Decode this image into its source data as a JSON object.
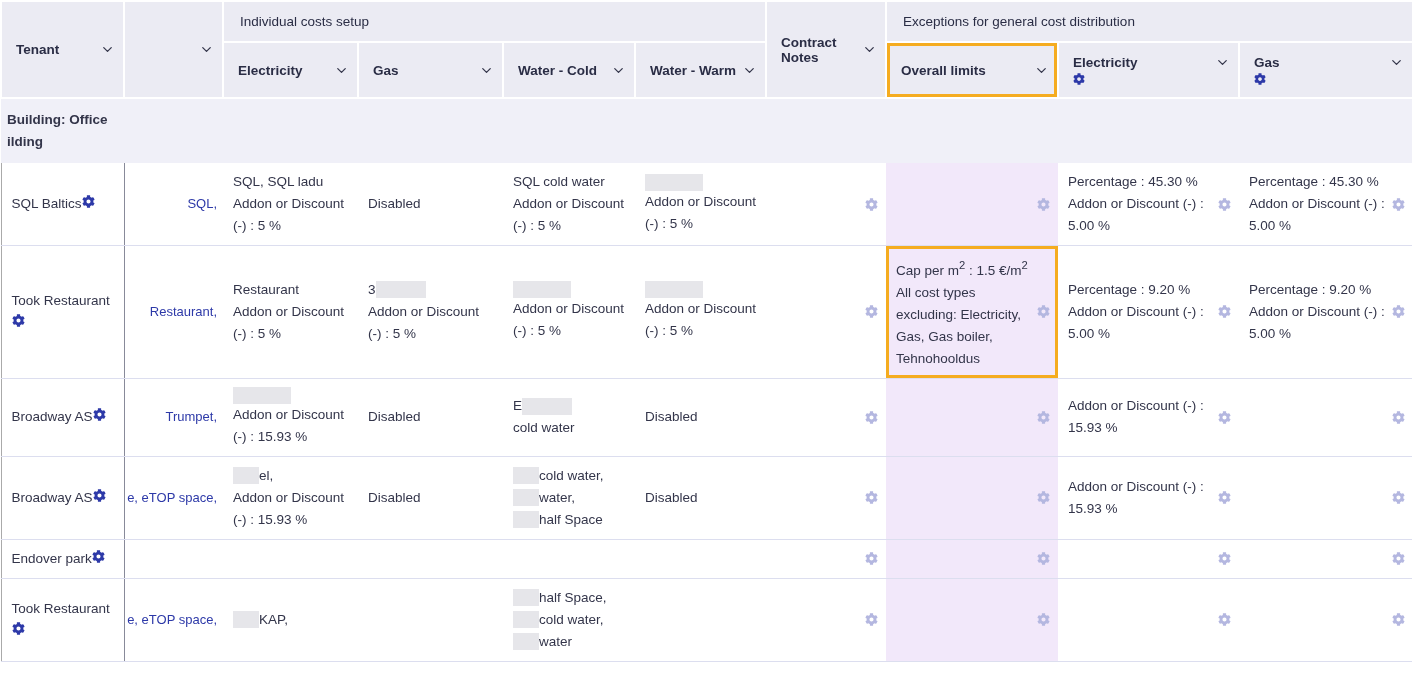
{
  "table": {
    "header": [
      {
        "kind": "column",
        "label": "Tenant"
      },
      {
        "kind": "column"
      },
      {
        "kind": "group",
        "label": "Individual costs setup",
        "columns": [
          {
            "label": "Electricity",
            "gear": false,
            "highlighted": false
          },
          {
            "label": "Gas",
            "gear": false,
            "highlighted": false
          },
          {
            "label": "Water - Cold",
            "gear": false,
            "highlighted": false
          },
          {
            "label": "Water - Warm",
            "gear": false,
            "highlighted": false
          }
        ]
      },
      {
        "kind": "column",
        "label": "Contract Notes"
      },
      {
        "kind": "group",
        "label": "Exceptions for general cost distribution",
        "columns": [
          {
            "label": "Overall limits",
            "gear": false,
            "highlighted": true
          },
          {
            "label": "Electricity",
            "gear": true,
            "highlighted": false
          },
          {
            "label": "Gas",
            "gear": true,
            "highlighted": false
          }
        ]
      }
    ],
    "group_row": {
      "lines": [
        "Building: Office",
        "ilding"
      ]
    },
    "rows": [
      {
        "tenant": "SQL Baltics",
        "link": "SQL,",
        "costs": {
          "electricity": [
            "SQL, SQL ladu",
            "Addon or Discount (-) : 5 %"
          ],
          "gas": [
            "Disabled"
          ],
          "water_cold": [
            "SQL cold water",
            "Addon or Discount (-) : 5 %"
          ],
          "water_warm": [
            {
              "kind": "masked"
            },
            "Addon or Discount (-) : 5 %"
          ]
        },
        "overall": {
          "highlighted": false
        },
        "exceptions": {
          "electricity": [
            "Percentage : 45.30 %",
            "Addon or Discount (-) : 5.00 %"
          ],
          "gas": [
            "Percentage : 45.30 %",
            "Addon or Discount (-) : 5.00 %"
          ]
        }
      },
      {
        "tenant": "Took Restaurant",
        "link": "Restaurant,",
        "costs": {
          "electricity": [
            "Restaurant",
            "Addon or Discount (-) : 5 %"
          ],
          "gas": [
            {
              "kind": "prefix",
              "text": "3"
            },
            "Addon or Discount (-) : 5 %"
          ],
          "water_cold": [
            {
              "kind": "masked"
            },
            "Addon or Discount (-) : 5 %"
          ],
          "water_warm": [
            {
              "kind": "masked"
            },
            "Addon or Discount (-) : 5 %"
          ]
        },
        "overall": {
          "highlighted": true,
          "lines": [
            "Cap per m$^{2}$ : 1.5 €/m$^{2}$",
            "All cost types excluding: Electricity, Gas, Gas boiler, Tehnohooldus"
          ]
        },
        "exceptions": {
          "electricity": [
            "Percentage : 9.20 %",
            "Addon or Discount (-) : 5.00 %"
          ],
          "gas": [
            "Percentage : 9.20 %",
            "Addon or Discount (-) : 5.00 %"
          ]
        }
      },
      {
        "tenant": "Broadway AS",
        "link": "Trumpet,",
        "costs": {
          "electricity": [
            {
              "kind": "masked"
            },
            "Addon or Discount (-) : 15.93 %"
          ],
          "gas": [
            "Disabled"
          ],
          "water_cold": [
            {
              "kind": "prefix",
              "text": "E"
            },
            "cold water"
          ],
          "water_warm": [
            "Disabled"
          ]
        },
        "overall": {
          "highlighted": false
        },
        "exceptions": {
          "electricity": [
            "Addon or Discount (-) : 15.93 %"
          ]
        }
      },
      {
        "tenant": "Broadway AS",
        "link": "e, eTOP space,",
        "costs": {
          "electricity": [
            {
              "kind": "suffix",
              "text": "el,"
            },
            "Addon or Discount (-) : 15.93 %"
          ],
          "gas": [
            "Disabled"
          ],
          "water_cold": [
            {
              "kind": "suffix",
              "text": "cold water,"
            },
            {
              "kind": "suffix",
              "text": "water,"
            },
            {
              "kind": "suffix",
              "text": "half Space"
            }
          ],
          "water_warm": [
            "Disabled"
          ]
        },
        "overall": {
          "highlighted": false
        },
        "exceptions": {
          "electricity": [
            "Addon or Discount (-) : 15.93 %"
          ]
        }
      },
      {
        "tenant": "Endover park",
        "overall": {
          "highlighted": false
        }
      },
      {
        "tenant": "Took Restaurant",
        "link": "e, eTOP space,",
        "costs": {
          "electricity": [
            {
              "kind": "suffix",
              "text": "KAP,"
            }
          ],
          "water_cold": [
            {
              "kind": "suffix",
              "text": "half Space,"
            },
            {
              "kind": "suffix",
              "text": "cold water,"
            },
            {
              "kind": "suffix",
              "text": "water"
            }
          ]
        },
        "overall": {
          "highlighted": false
        }
      }
    ]
  }
}
